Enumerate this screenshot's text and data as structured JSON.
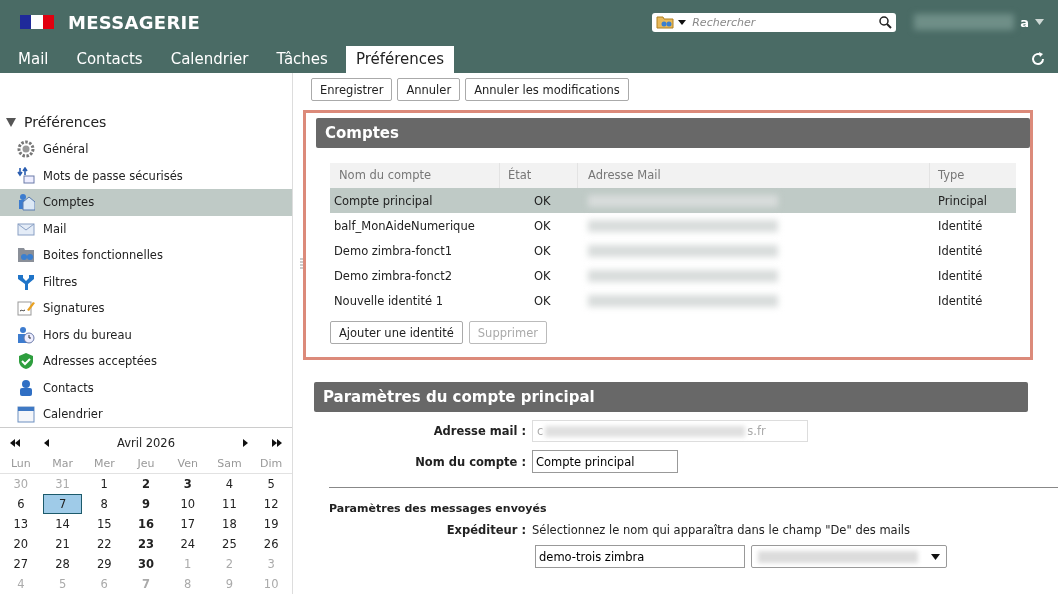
{
  "app": {
    "title": "MESSAGERIE",
    "search": {
      "placeholder": "Rechercher"
    },
    "user": {
      "visible_text": "a"
    }
  },
  "tabs": [
    {
      "label": "Mail",
      "selected": false
    },
    {
      "label": "Contacts",
      "selected": false
    },
    {
      "label": "Calendrier",
      "selected": false
    },
    {
      "label": "Tâches",
      "selected": false
    },
    {
      "label": "Préférences",
      "selected": true
    }
  ],
  "toolbar": [
    "Enregistrer",
    "Annuler",
    "Annuler les modifications"
  ],
  "sidebar": {
    "title": "Préférences",
    "expanded": true,
    "items": [
      {
        "label": "Général",
        "selected": false
      },
      {
        "label": "Mots de passe sécurisés",
        "selected": false
      },
      {
        "label": "Comptes",
        "selected": true
      },
      {
        "label": "Mail",
        "selected": false
      },
      {
        "label": "Boites fonctionnelles",
        "selected": false
      },
      {
        "label": "Filtres",
        "selected": false
      },
      {
        "label": "Signatures",
        "selected": false
      },
      {
        "label": "Hors du bureau",
        "selected": false
      },
      {
        "label": "Adresses acceptées",
        "selected": false
      },
      {
        "label": "Contacts",
        "selected": false
      },
      {
        "label": "Calendrier",
        "selected": false
      }
    ]
  },
  "calendar": {
    "month": "Avril 2026",
    "weekdays": [
      "Lun",
      "Mar",
      "Mer",
      "Jeu",
      "Ven",
      "Sam",
      "Dim"
    ],
    "days": [
      {
        "label": "30",
        "other_month": true,
        "bold": false,
        "selected": false
      },
      {
        "label": "31",
        "other_month": true,
        "bold": false,
        "selected": false
      },
      {
        "label": "1",
        "other_month": false,
        "bold": false,
        "selected": false
      },
      {
        "label": "2",
        "other_month": false,
        "bold": true,
        "selected": false
      },
      {
        "label": "3",
        "other_month": false,
        "bold": true,
        "selected": false
      },
      {
        "label": "4",
        "other_month": false,
        "bold": false,
        "selected": false
      },
      {
        "label": "5",
        "other_month": false,
        "bold": false,
        "selected": false
      },
      {
        "label": "6",
        "other_month": false,
        "bold": false,
        "selected": false
      },
      {
        "label": "7",
        "other_month": false,
        "bold": false,
        "selected": true
      },
      {
        "label": "8",
        "other_month": false,
        "bold": false,
        "selected": false
      },
      {
        "label": "9",
        "other_month": false,
        "bold": true,
        "selected": false
      },
      {
        "label": "10",
        "other_month": false,
        "bold": false,
        "selected": false
      },
      {
        "label": "11",
        "other_month": false,
        "bold": false,
        "selected": false
      },
      {
        "label": "12",
        "other_month": false,
        "bold": false,
        "selected": false
      },
      {
        "label": "13",
        "other_month": false,
        "bold": false,
        "selected": false
      },
      {
        "label": "14",
        "other_month": false,
        "bold": false,
        "selected": false
      },
      {
        "label": "15",
        "other_month": false,
        "bold": false,
        "selected": false
      },
      {
        "label": "16",
        "other_month": false,
        "bold": true,
        "selected": false
      },
      {
        "label": "17",
        "other_month": false,
        "bold": false,
        "selected": false
      },
      {
        "label": "18",
        "other_month": false,
        "bold": false,
        "selected": false
      },
      {
        "label": "19",
        "other_month": false,
        "bold": false,
        "selected": false
      },
      {
        "label": "20",
        "other_month": false,
        "bold": false,
        "selected": false
      },
      {
        "label": "21",
        "other_month": false,
        "bold": false,
        "selected": false
      },
      {
        "label": "22",
        "other_month": false,
        "bold": false,
        "selected": false
      },
      {
        "label": "23",
        "other_month": false,
        "bold": true,
        "selected": false
      },
      {
        "label": "24",
        "other_month": false,
        "bold": false,
        "selected": false
      },
      {
        "label": "25",
        "other_month": false,
        "bold": false,
        "selected": false
      },
      {
        "label": "26",
        "other_month": false,
        "bold": false,
        "selected": false
      },
      {
        "label": "27",
        "other_month": false,
        "bold": false,
        "selected": false
      },
      {
        "label": "28",
        "other_month": false,
        "bold": false,
        "selected": false
      },
      {
        "label": "29",
        "other_month": false,
        "bold": false,
        "selected": false
      },
      {
        "label": "30",
        "other_month": false,
        "bold": true,
        "selected": false
      },
      {
        "label": "1",
        "other_month": true,
        "bold": false,
        "selected": false
      },
      {
        "label": "2",
        "other_month": true,
        "bold": false,
        "selected": false
      },
      {
        "label": "3",
        "other_month": true,
        "bold": false,
        "selected": false
      },
      {
        "label": "4",
        "other_month": true,
        "bold": false,
        "selected": false
      },
      {
        "label": "5",
        "other_month": true,
        "bold": false,
        "selected": false
      },
      {
        "label": "6",
        "other_month": true,
        "bold": false,
        "selected": false
      },
      {
        "label": "7",
        "other_month": true,
        "bold": true,
        "selected": false
      },
      {
        "label": "8",
        "other_month": true,
        "bold": false,
        "selected": false
      },
      {
        "label": "9",
        "other_month": true,
        "bold": false,
        "selected": false
      },
      {
        "label": "10",
        "other_month": true,
        "bold": false,
        "selected": false
      }
    ]
  },
  "accounts": {
    "title": "Comptes",
    "columns": [
      "Nom du compte",
      "État",
      "Adresse Mail",
      "Type"
    ],
    "rows": [
      {
        "name": "Compte principal",
        "state": "OK",
        "type": "Principal",
        "selected": true
      },
      {
        "name": "balf_MonAideNumerique",
        "state": "OK",
        "type": "Identité",
        "selected": false
      },
      {
        "name": "Demo zimbra-fonct1",
        "state": "OK",
        "type": "Identité",
        "selected": false
      },
      {
        "name": "Demo zimbra-fonct2",
        "state": "OK",
        "type": "Identité",
        "selected": false
      },
      {
        "name": "Nouvelle identité 1",
        "state": "OK",
        "type": "Identité",
        "selected": false
      }
    ],
    "buttons": [
      {
        "label": "Ajouter une identité",
        "disabled": false
      },
      {
        "label": "Supprimer",
        "disabled": true
      }
    ]
  },
  "settings": {
    "title": "Paramètres du compte principal",
    "email": {
      "label": "Adresse mail :",
      "value_start": "c",
      "value_end": "s.fr"
    },
    "account_name": {
      "label": "Nom du compte :",
      "value": "Compte principal"
    },
    "sent_section": "Paramètres des messages envoyés",
    "sender": {
      "label": "Expéditeur :",
      "hint": "Sélectionnez le nom qui apparaîtra dans le champ \"De\" des mails",
      "value": "demo-trois zimbra"
    }
  }
}
